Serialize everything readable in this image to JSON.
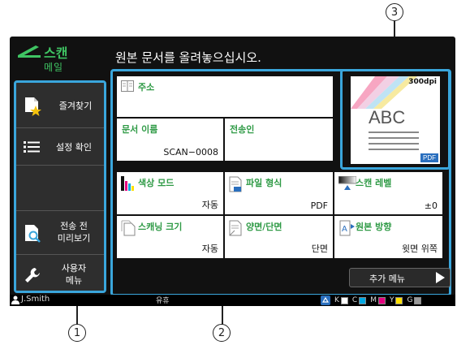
{
  "mode": {
    "title": "스캔",
    "subtitle": "메일"
  },
  "header": {
    "message": "원본 문서를 올려놓으십시오."
  },
  "sidebar": {
    "items": [
      {
        "label": "즐겨찾기",
        "icon": "star-document-icon"
      },
      {
        "label": "설정 확인",
        "icon": "list-icon"
      },
      {
        "label": "전송 전\n미리보기",
        "icon": "magnifier-document-icon"
      },
      {
        "label": "사용자\n메뉴",
        "icon": "wrench-icon"
      }
    ]
  },
  "cards": {
    "address": {
      "title": "주소",
      "icon": "address-book-icon"
    },
    "doc_name": {
      "title": "문서 이름",
      "value": "SCAN−0008"
    },
    "sender": {
      "title": "전송인",
      "value": ""
    },
    "color_mode": {
      "title": "색상 모드",
      "value": "자동",
      "icon": "color-bars-icon"
    },
    "file_format": {
      "title": "파일 형식",
      "value": "PDF",
      "icon": "file-format-icon"
    },
    "scan_level": {
      "title": "스캔 레벨",
      "value": "±0",
      "icon": "level-gradient-icon"
    },
    "scan_size": {
      "title": "스캐닝 크기",
      "value": "자동",
      "icon": "scan-size-icon"
    },
    "duplex": {
      "title": "양면/단면",
      "value": "단면",
      "icon": "duplex-icon"
    },
    "orientation": {
      "title": "원본 방향",
      "value": "윗면 위쪽",
      "icon": "orientation-icon"
    }
  },
  "preview": {
    "dpi": "300dpi",
    "sample_text": "ABC",
    "format_badge": "PDF"
  },
  "more_menu": {
    "label": "추가 메뉴"
  },
  "statusbar": {
    "user": "J.Smith",
    "status": "유휴",
    "toner": [
      {
        "label": "K",
        "color": "#ffffff"
      },
      {
        "label": "C",
        "color": "#00a7e1"
      },
      {
        "label": "M",
        "color": "#e4007f"
      },
      {
        "label": "Y",
        "color": "#ffe100"
      },
      {
        "label": "G",
        "color": "#9a9a9a"
      }
    ]
  },
  "callouts": [
    "1",
    "2",
    "3"
  ],
  "colors": {
    "accent": "#3aa6dc",
    "mode_green": "#3fc463",
    "title_green": "#2e9a45"
  }
}
